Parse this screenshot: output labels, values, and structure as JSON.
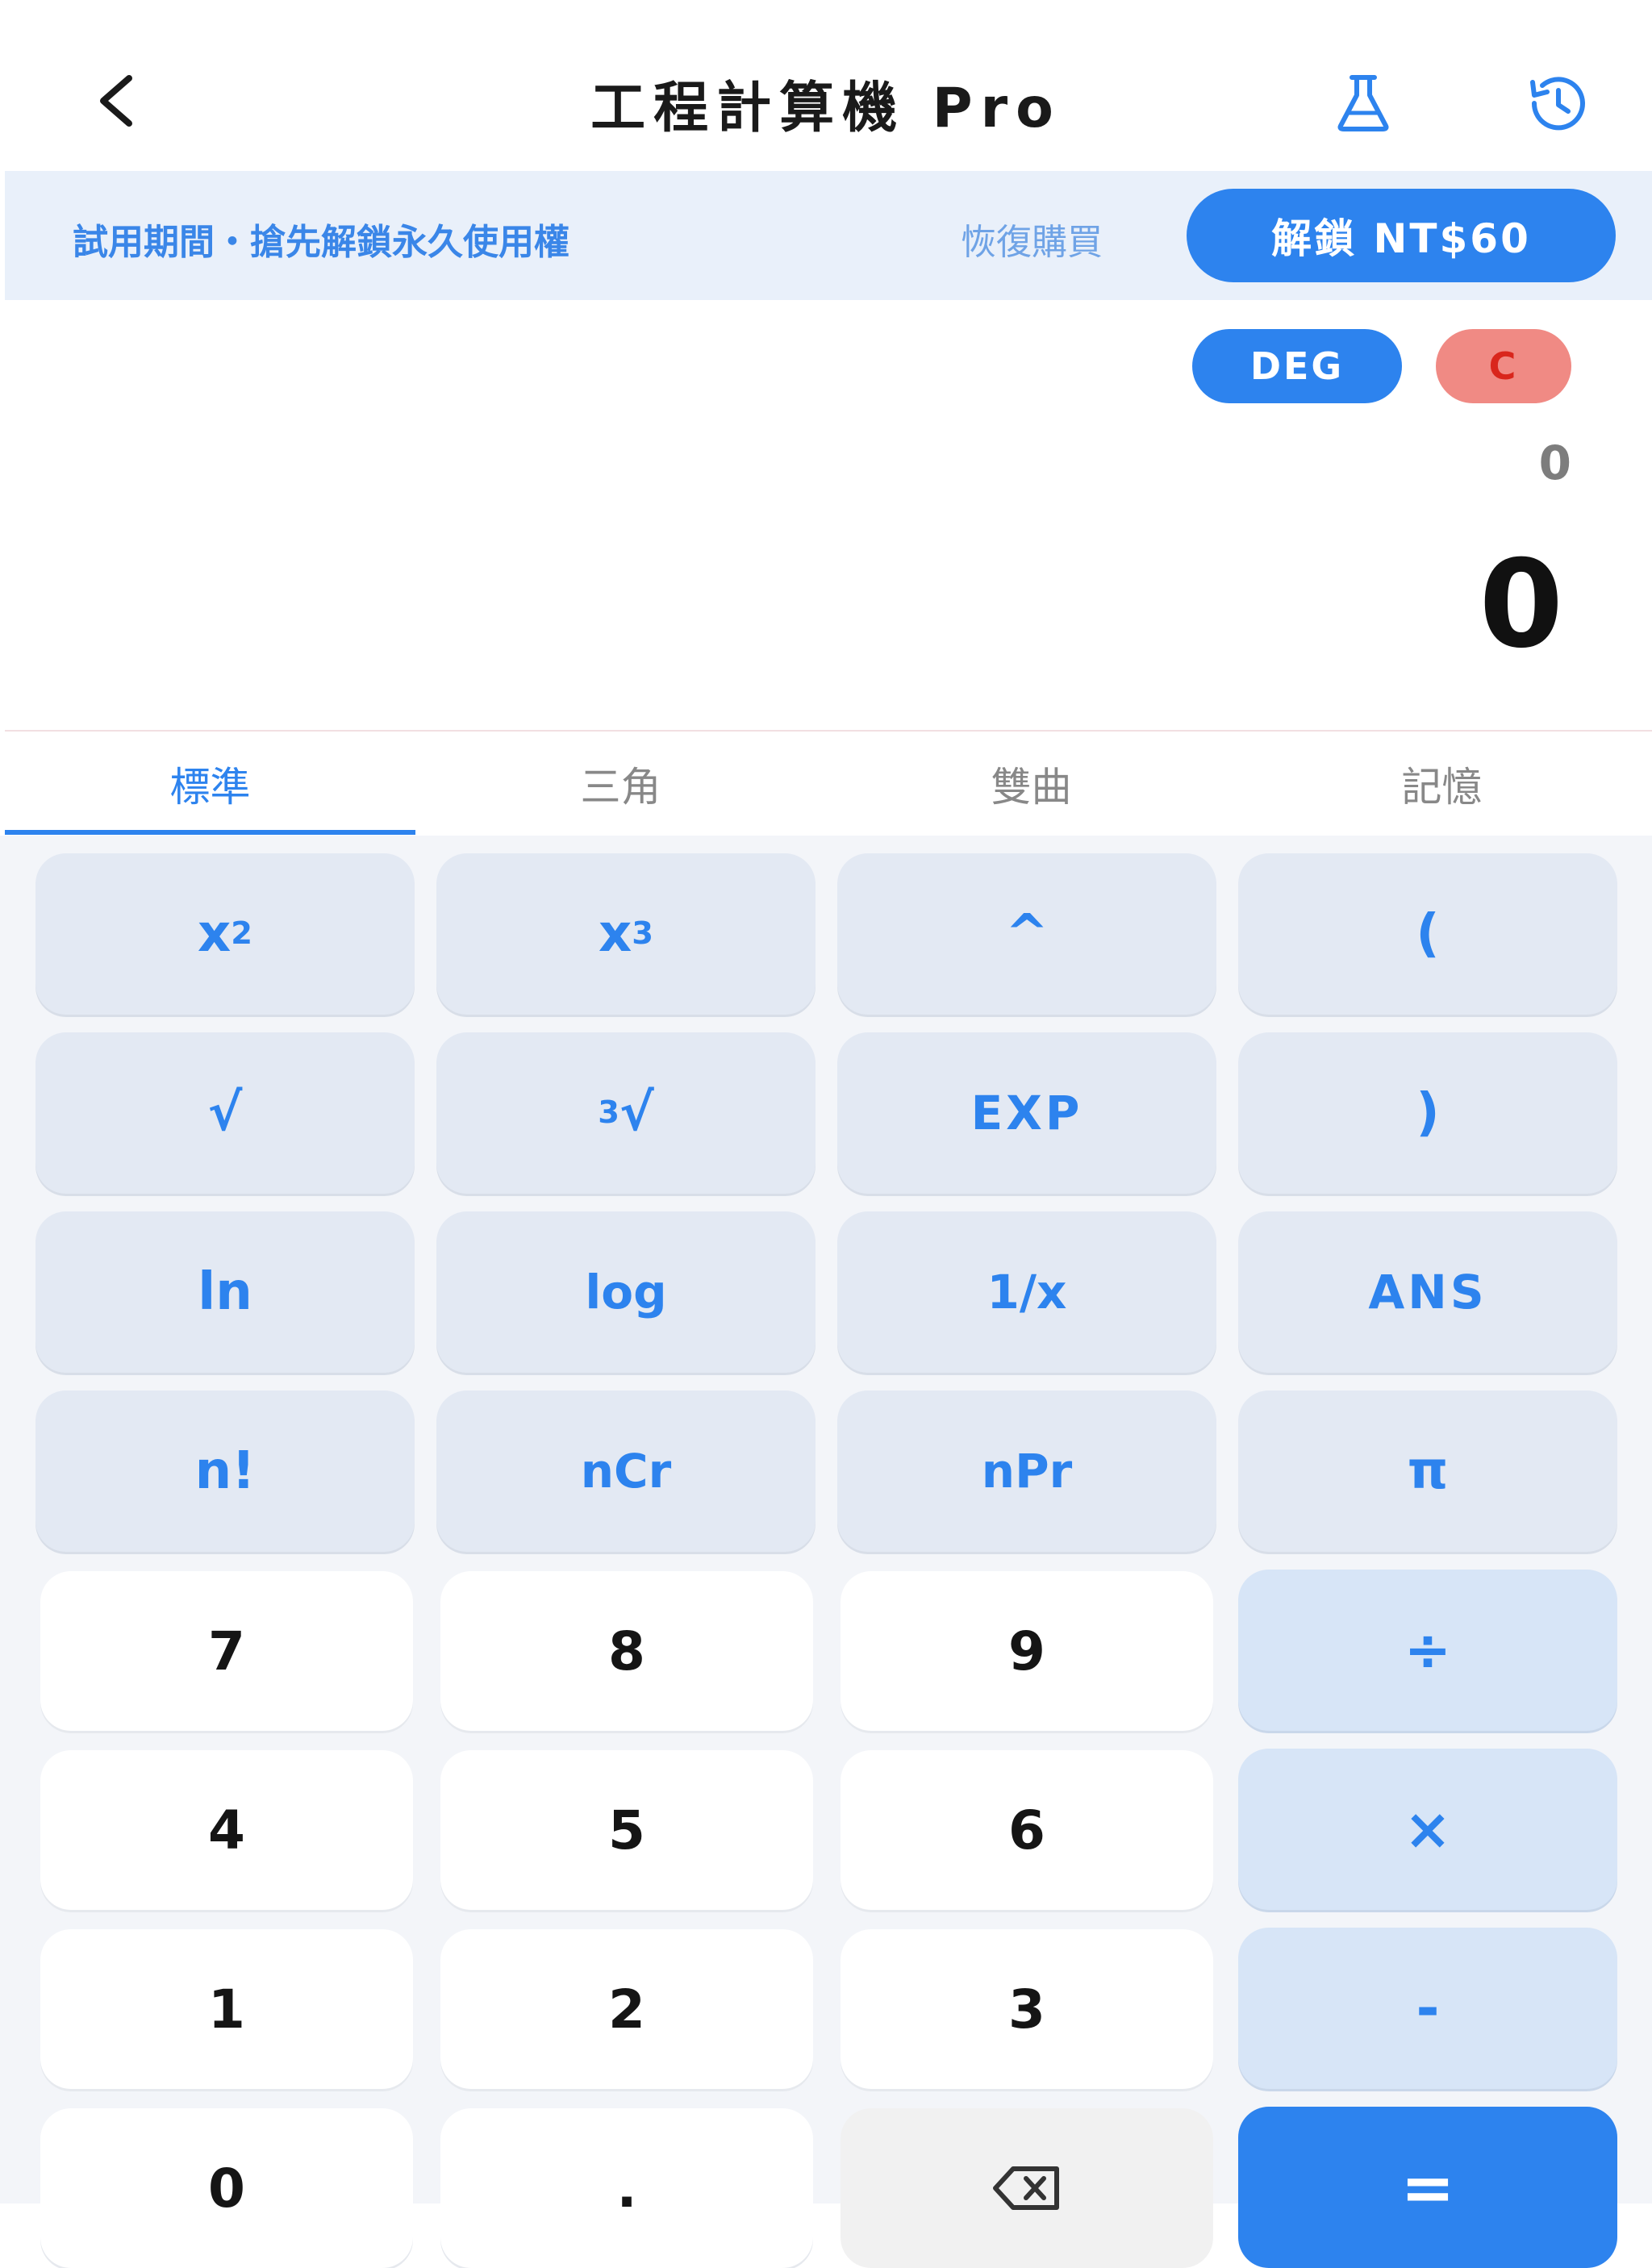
{
  "header": {
    "title": "工程計算機 Pro"
  },
  "banner": {
    "trial_text": "試用期間・搶先解鎖永久使用權",
    "restore_label": "恢復購買",
    "unlock_label": "解鎖 NT$60"
  },
  "display": {
    "angle_mode": "DEG",
    "clear_label": "C",
    "expression": "0",
    "result": "0"
  },
  "tabs": [
    "標準",
    "三角",
    "雙曲",
    "記憶"
  ],
  "active_tab": "標準",
  "keys": {
    "x_base": "x",
    "square_exp": "2",
    "cube_exp": "3",
    "power": "^",
    "lparen": "(",
    "sqrt": "√",
    "cbrt_index": "3",
    "cbrt_radical": "√",
    "exp": "EXP",
    "rparen": ")",
    "ln": "ln",
    "log": "log",
    "reciprocal": "1/x",
    "ans": "ANS",
    "factorial": "n!",
    "ncr": "nCr",
    "npr": "nPr",
    "pi": "π",
    "d7": "7",
    "d8": "8",
    "d9": "9",
    "divide": "÷",
    "d4": "4",
    "d5": "5",
    "d6": "6",
    "multiply": "×",
    "d1": "1",
    "d2": "2",
    "d3": "3",
    "minus": "-",
    "d0": "0",
    "dot": ".",
    "equals": "="
  },
  "colors": {
    "accent": "#2d83ee",
    "clear": "#f08a84",
    "function_key": "#e3e9f3",
    "operator_key": "#d7e5f7"
  },
  "icons": {
    "back": "chevron-left-icon",
    "lab": "beaker-icon",
    "history": "history-icon",
    "backspace": "backspace-icon"
  }
}
